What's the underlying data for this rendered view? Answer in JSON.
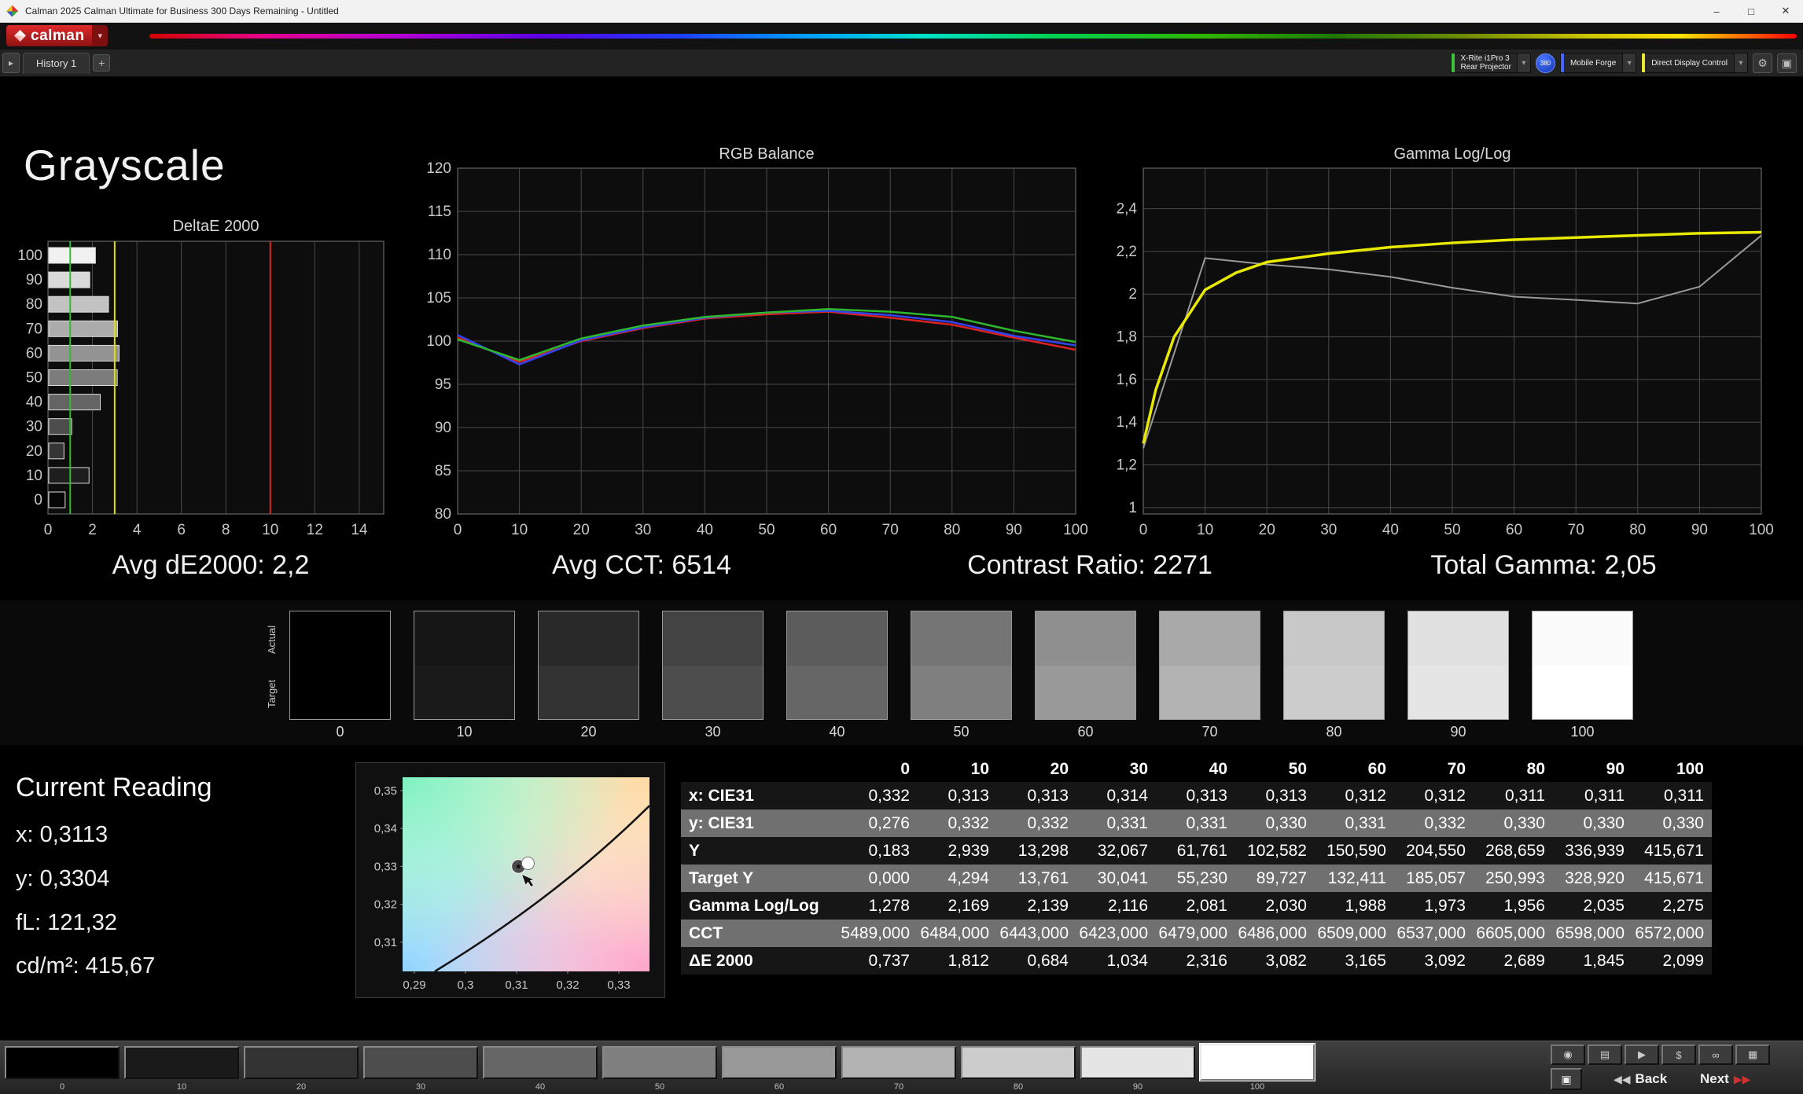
{
  "window": {
    "title": "Calman 2025 Calman Ultimate for Business 300 Days Remaining - Untitled",
    "minimize": "–",
    "maximize": "□",
    "close": "✕"
  },
  "toolbar": {
    "brand": "calman",
    "brand_chevron": "▾"
  },
  "tab_bar": {
    "expander": "▸",
    "history_tab": "History 1",
    "add_button": "+",
    "meter_line1": "X-Rite i1Pro 3",
    "meter_line2": "Rear Projector",
    "meter_accent": "#3cc43c",
    "badge": "380",
    "source_label": "Mobile Forge",
    "source_accent": "#4466ff",
    "display_control_label": "Direct Display Control",
    "display_control_accent": "#e8e830",
    "chevron": "▾",
    "gear": "⚙",
    "panel": "▣"
  },
  "page": {
    "title": "Grayscale"
  },
  "summary": [
    "Avg dE2000: 2,2",
    "Avg CCT: 6514",
    "Contrast Ratio: 2271",
    "Total Gamma: 2,05"
  ],
  "swatch_strip": {
    "actual_label": "Actual",
    "target_label": "Target",
    "levels": [
      "0",
      "10",
      "20",
      "30",
      "40",
      "50",
      "60",
      "70",
      "80",
      "90",
      "100"
    ]
  },
  "current_reading": {
    "title": "Current Reading",
    "lines": [
      "x: 0,3113",
      "y: 0,3304",
      "fL: 121,32",
      "cd/m²: 415,67"
    ]
  },
  "table": {
    "columns": [
      "",
      "0",
      "10",
      "20",
      "30",
      "40",
      "50",
      "60",
      "70",
      "80",
      "90",
      "100"
    ],
    "rows": [
      {
        "label": "x: CIE31",
        "shade": false,
        "values": [
          "0,332",
          "0,313",
          "0,313",
          "0,314",
          "0,313",
          "0,313",
          "0,312",
          "0,312",
          "0,311",
          "0,311",
          "0,311"
        ]
      },
      {
        "label": "y: CIE31",
        "shade": true,
        "values": [
          "0,276",
          "0,332",
          "0,332",
          "0,331",
          "0,331",
          "0,330",
          "0,331",
          "0,332",
          "0,330",
          "0,330",
          "0,330"
        ]
      },
      {
        "label": "Y",
        "shade": false,
        "values": [
          "0,183",
          "2,939",
          "13,298",
          "32,067",
          "61,761",
          "102,582",
          "150,590",
          "204,550",
          "268,659",
          "336,939",
          "415,671"
        ]
      },
      {
        "label": "Target Y",
        "shade": true,
        "values": [
          "0,000",
          "4,294",
          "13,761",
          "30,041",
          "55,230",
          "89,727",
          "132,411",
          "185,057",
          "250,993",
          "328,920",
          "415,671"
        ]
      },
      {
        "label": "Gamma Log/Log",
        "shade": false,
        "values": [
          "1,278",
          "2,169",
          "2,139",
          "2,116",
          "2,081",
          "2,030",
          "1,988",
          "1,973",
          "1,956",
          "2,035",
          "2,275"
        ]
      },
      {
        "label": "CCT",
        "shade": true,
        "values": [
          "5489,000",
          "6484,000",
          "6443,000",
          "6423,000",
          "6479,000",
          "6486,000",
          "6509,000",
          "6537,000",
          "6605,000",
          "6598,000",
          "6572,000"
        ]
      },
      {
        "label": "ΔE 2000",
        "shade": false,
        "values": [
          "0,737",
          "1,812",
          "0,684",
          "1,034",
          "2,316",
          "3,082",
          "3,165",
          "3,092",
          "2,689",
          "1,845",
          "2,099"
        ]
      }
    ]
  },
  "chart_data": [
    {
      "type": "bar",
      "orientation": "horizontal",
      "title": "DeltaE 2000",
      "categories": [
        100,
        90,
        80,
        70,
        60,
        50,
        40,
        30,
        20,
        10,
        0
      ],
      "values": [
        2.099,
        1.845,
        2.689,
        3.092,
        3.165,
        3.082,
        2.316,
        1.034,
        0.684,
        1.812,
        0.737
      ],
      "xlim": [
        0,
        15.1
      ],
      "xticks": [
        0,
        2,
        4,
        6,
        8,
        10,
        12,
        14
      ],
      "reference_lines": [
        {
          "name": "good",
          "value": 1,
          "color": "#33bb33"
        },
        {
          "name": "warn",
          "value": 3,
          "color": "#e0e000"
        },
        {
          "name": "limit",
          "value": 10,
          "color": "#dd2222"
        }
      ]
    },
    {
      "type": "line",
      "title": "RGB Balance",
      "x": [
        0,
        10,
        20,
        30,
        40,
        50,
        60,
        70,
        80,
        90,
        100
      ],
      "xlim": [
        0,
        100
      ],
      "xticks": [
        0,
        10,
        20,
        30,
        40,
        50,
        60,
        70,
        80,
        90,
        100
      ],
      "ylim": [
        80,
        120
      ],
      "yticks": [
        80,
        85,
        90,
        95,
        100,
        105,
        110,
        115,
        120
      ],
      "series": [
        {
          "name": "red-balance",
          "color": "#dd2222",
          "values": [
            100.4,
            97.6,
            100.0,
            101.5,
            102.6,
            103.1,
            103.4,
            102.7,
            101.9,
            100.4,
            99.0
          ]
        },
        {
          "name": "blue-balance",
          "color": "#3344ee",
          "values": [
            100.7,
            97.3,
            100.1,
            101.6,
            102.7,
            103.3,
            103.5,
            103.0,
            102.2,
            100.6,
            99.5
          ]
        },
        {
          "name": "green-balance",
          "color": "#2db82d",
          "values": [
            100.2,
            97.8,
            100.3,
            101.8,
            102.8,
            103.3,
            103.7,
            103.4,
            102.8,
            101.2,
            99.9
          ]
        }
      ]
    },
    {
      "type": "line",
      "title": "Gamma Log/Log",
      "xlim": [
        0,
        100
      ],
      "xticks": [
        0,
        10,
        20,
        30,
        40,
        50,
        60,
        70,
        80,
        90,
        100
      ],
      "ylim": [
        0.97,
        2.59
      ],
      "yticks": [
        2.4,
        2.2,
        2.0,
        1.8,
        1.6,
        1.4,
        1.2,
        1.0
      ],
      "ytick_labels": [
        "2,4",
        "2,2",
        "2",
        "1,8",
        "1,6",
        "1,4",
        "1,2",
        "1"
      ],
      "series": [
        {
          "name": "point-gamma",
          "color": "#999999",
          "width": 2,
          "x": [
            0,
            10,
            20,
            30,
            40,
            50,
            60,
            70,
            80,
            90,
            100
          ],
          "values": [
            1.278,
            2.169,
            2.139,
            2.116,
            2.081,
            2.03,
            1.988,
            1.973,
            1.956,
            2.035,
            2.275
          ]
        },
        {
          "name": "measured-gamma",
          "color": "#e8e800",
          "width": 3.5,
          "x": [
            0,
            2,
            5,
            10,
            15,
            20,
            30,
            40,
            50,
            60,
            70,
            80,
            90,
            100
          ],
          "values": [
            1.3,
            1.55,
            1.8,
            2.02,
            2.1,
            2.15,
            2.19,
            2.22,
            2.24,
            2.255,
            2.265,
            2.275,
            2.285,
            2.29
          ]
        }
      ]
    },
    {
      "type": "scatter",
      "title": "",
      "xlim": [
        0.2877,
        0.336
      ],
      "ylim": [
        0.3023,
        0.3535
      ],
      "xticks": [
        0.29,
        0.3,
        0.31,
        0.32,
        0.33
      ],
      "xtick_labels": [
        "0,29",
        "0,3",
        "0,31",
        "0,32",
        "0,33"
      ],
      "yticks": [
        0.35,
        0.34,
        0.33,
        0.32,
        0.31
      ],
      "ytick_labels": [
        "0,35",
        "0,34",
        "0,33",
        "0,32",
        "0,31"
      ],
      "point": {
        "x": 0.3113,
        "y": 0.3304
      }
    }
  ],
  "bottom_bar": {
    "levels": [
      "0",
      "10",
      "20",
      "30",
      "40",
      "50",
      "60",
      "70",
      "80",
      "90",
      "100"
    ],
    "selected": "100",
    "tools": [
      {
        "name": "meter-icon",
        "glyph": "◉"
      },
      {
        "name": "pattern-window-icon",
        "glyph": "▤"
      },
      {
        "name": "play-icon",
        "glyph": "▶"
      },
      {
        "name": "license-icon",
        "glyph": "$"
      },
      {
        "name": "continuous-measure-icon",
        "glyph": "∞"
      },
      {
        "name": "levels-icon",
        "glyph": "▦"
      }
    ],
    "stop_glyph": "▣",
    "back_icon": "◀◀",
    "back_label": "Back",
    "next_label": "Next",
    "next_icon": "▶▶"
  }
}
